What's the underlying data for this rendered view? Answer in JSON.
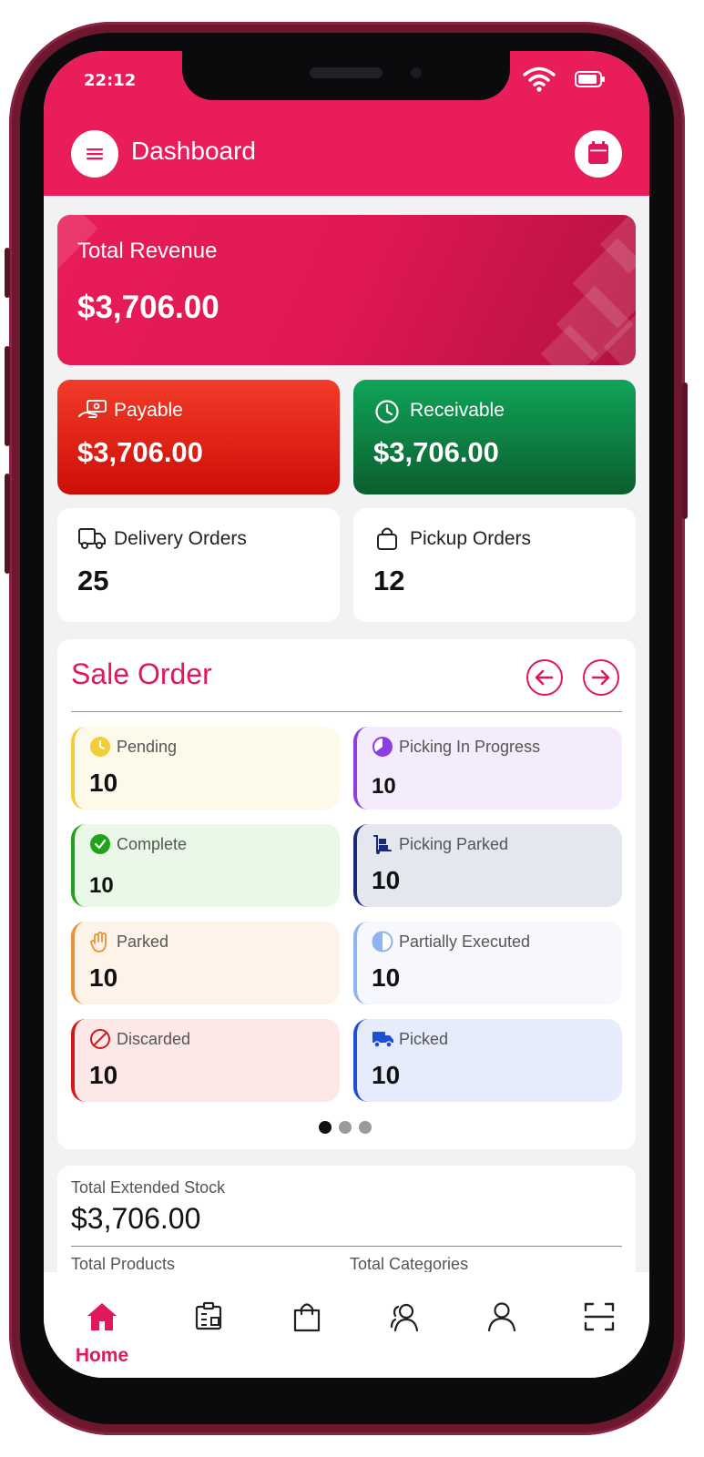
{
  "status_bar": {
    "time": "22:12"
  },
  "header": {
    "title": "Dashboard"
  },
  "revenue": {
    "label": "Total Revenue",
    "value": "$3,706.00"
  },
  "payable": {
    "label": "Payable",
    "value": "$3,706.00"
  },
  "receivable": {
    "label": "Receivable",
    "value": "$3,706.00"
  },
  "delivery_orders": {
    "label": "Delivery Orders",
    "value": "25"
  },
  "pickup_orders": {
    "label": "Pickup Orders",
    "value": "12"
  },
  "sale_order": {
    "title": "Sale Order",
    "statuses": [
      {
        "label": "Pending",
        "value": "10"
      },
      {
        "label": "Picking In Progress",
        "value": "10"
      },
      {
        "label": "Complete",
        "value": "10"
      },
      {
        "label": "Picking Parked",
        "value": "10"
      },
      {
        "label": "Parked",
        "value": "10"
      },
      {
        "label": "Partially Executed",
        "value": "10"
      },
      {
        "label": "Discarded",
        "value": "10"
      },
      {
        "label": "Picked",
        "value": "10"
      }
    ],
    "page_indicator": {
      "current": 1,
      "total": 3
    }
  },
  "stock": {
    "label": "Total Extended Stock",
    "value": "$3,706.00",
    "products_label": "Total Products",
    "categories_label": "Total Categories"
  },
  "nav": {
    "home_label": "Home",
    "items": [
      "home-icon",
      "inventory-icon",
      "shopping-bag-icon",
      "customers-icon",
      "profile-icon",
      "scan-icon"
    ]
  },
  "colors": {
    "brand": "#ea1d5b",
    "payable": "#e0241a",
    "receivable": "#0e8a47",
    "pending": "#f2cc3a",
    "picking_in_progress": "#8b3fe0",
    "complete": "#22a21c",
    "picking_parked": "#1a2a78",
    "parked": "#e8933a",
    "partially_executed": "#8fb2f0",
    "discarded": "#d21a1a",
    "picked": "#1c4fd6"
  }
}
